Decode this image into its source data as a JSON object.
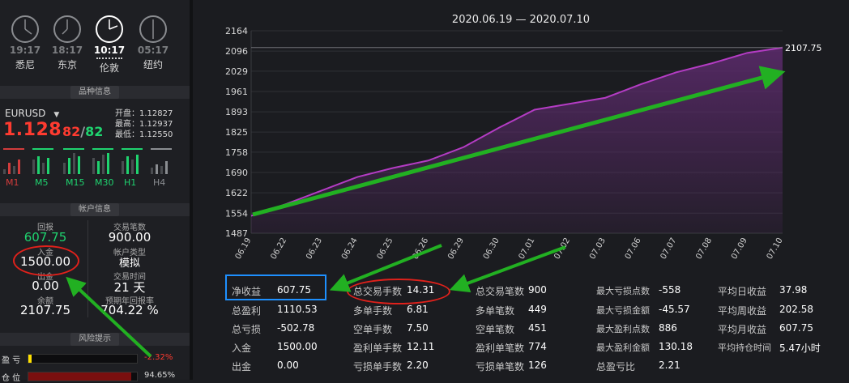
{
  "clocks": [
    {
      "time": "19:17",
      "city": "悉尼",
      "active": false
    },
    {
      "time": "18:17",
      "city": "东京",
      "active": false
    },
    {
      "time": "10:17",
      "city": "伦敦",
      "active": true
    },
    {
      "time": "05:17",
      "city": "纽约",
      "active": false
    }
  ],
  "sections": {
    "product": "品种信息",
    "account": "帐户信息",
    "risk": "风险提示"
  },
  "quote": {
    "symbol": "EURUSD",
    "price_main": "1.128",
    "bid_tail": "82",
    "slash": "/",
    "ask_tail": "82",
    "open": "开盘：1.12827",
    "high": "最高：1.12937",
    "low": "最低：1.12550"
  },
  "timeframes": [
    {
      "label": "M1",
      "color": "#d23c3c"
    },
    {
      "label": "M5",
      "color": "#1fd36f"
    },
    {
      "label": "M15",
      "color": "#1fd36f"
    },
    {
      "label": "M30",
      "color": "#1fd36f"
    },
    {
      "label": "H1",
      "color": "#1fd36f"
    },
    {
      "label": "H4",
      "color": "#8a8d91"
    }
  ],
  "account": {
    "return_label": "回报",
    "return_value": "607.75",
    "trades_label": "交易笔数",
    "trades_value": "900.00",
    "deposit_label": "入金",
    "deposit_value": "1500.00",
    "type_label": "帐户类型",
    "type_value": "模拟",
    "withdraw_label": "出金",
    "withdraw_value": "0.00",
    "duration_label": "交易时间",
    "duration_value": "21 天",
    "balance_label": "余额",
    "balance_value": "2107.75",
    "annual_label": "预期年回报率",
    "annual_value": "704.22 %"
  },
  "risk": [
    {
      "label": "盈 亏",
      "value": "-2.32%",
      "fill": 0.02,
      "color": "#ffe000",
      "value_color": "#ff3b30"
    },
    {
      "label": "仓 位",
      "value": "94.65%",
      "fill": 0.9465,
      "color": "#7a0f0f",
      "value_color": "#d8d8d8"
    }
  ],
  "chart_data": {
    "type": "area",
    "title": "2020.06.19 — 2020.07.10",
    "categories": [
      "06.19",
      "06.22",
      "06.23",
      "06.24",
      "06.25",
      "06.26",
      "06.29",
      "06.30",
      "07.01",
      "07.02",
      "07.03",
      "07.06",
      "07.07",
      "07.08",
      "07.09",
      "07.10"
    ],
    "values": [
      1545,
      1585,
      1630,
      1675,
      1705,
      1730,
      1775,
      1840,
      1900,
      1920,
      1940,
      1985,
      2025,
      2055,
      2090,
      2107.75
    ],
    "yticks": [
      1487,
      1554,
      1622,
      1690,
      1758,
      1825,
      1893,
      1961,
      2029,
      2096,
      2164
    ],
    "ylim": [
      1487,
      2164
    ],
    "last_label": "2107.75",
    "line_color": "#b43cc4",
    "fill_color": "#5a2a6a"
  },
  "stats": [
    [
      {
        "k": "净收益",
        "v": "607.75"
      },
      {
        "k": "总盈利",
        "v": "1110.53"
      },
      {
        "k": "总亏损",
        "v": "-502.78"
      },
      {
        "k": "入金",
        "v": "1500.00"
      },
      {
        "k": "出金",
        "v": "0.00"
      }
    ],
    [
      {
        "k": "总交易手数",
        "v": "14.31"
      },
      {
        "k": "多单手数",
        "v": "6.81"
      },
      {
        "k": "空单手数",
        "v": "7.50"
      },
      {
        "k": "盈利单手数",
        "v": "12.11"
      },
      {
        "k": "亏损单手数",
        "v": "2.20"
      }
    ],
    [
      {
        "k": "总交易笔数",
        "v": "900"
      },
      {
        "k": "多单笔数",
        "v": "449"
      },
      {
        "k": "空单笔数",
        "v": "451"
      },
      {
        "k": "盈利单笔数",
        "v": "774"
      },
      {
        "k": "亏损单笔数",
        "v": "126"
      }
    ],
    [
      {
        "k": "最大亏损点数",
        "v": "-558"
      },
      {
        "k": "最大亏损金额",
        "v": "-45.57"
      },
      {
        "k": "最大盈利点数",
        "v": "886"
      },
      {
        "k": "最大盈利金额",
        "v": "130.18"
      },
      {
        "k": "总盈亏比",
        "v": "2.21"
      }
    ],
    [
      {
        "k": "平均日收益",
        "v": "37.98"
      },
      {
        "k": "平均周收益",
        "v": "202.58"
      },
      {
        "k": "平均月收益",
        "v": "607.75"
      },
      {
        "k": "平均持仓时间",
        "v": "5.47小时"
      }
    ]
  ]
}
